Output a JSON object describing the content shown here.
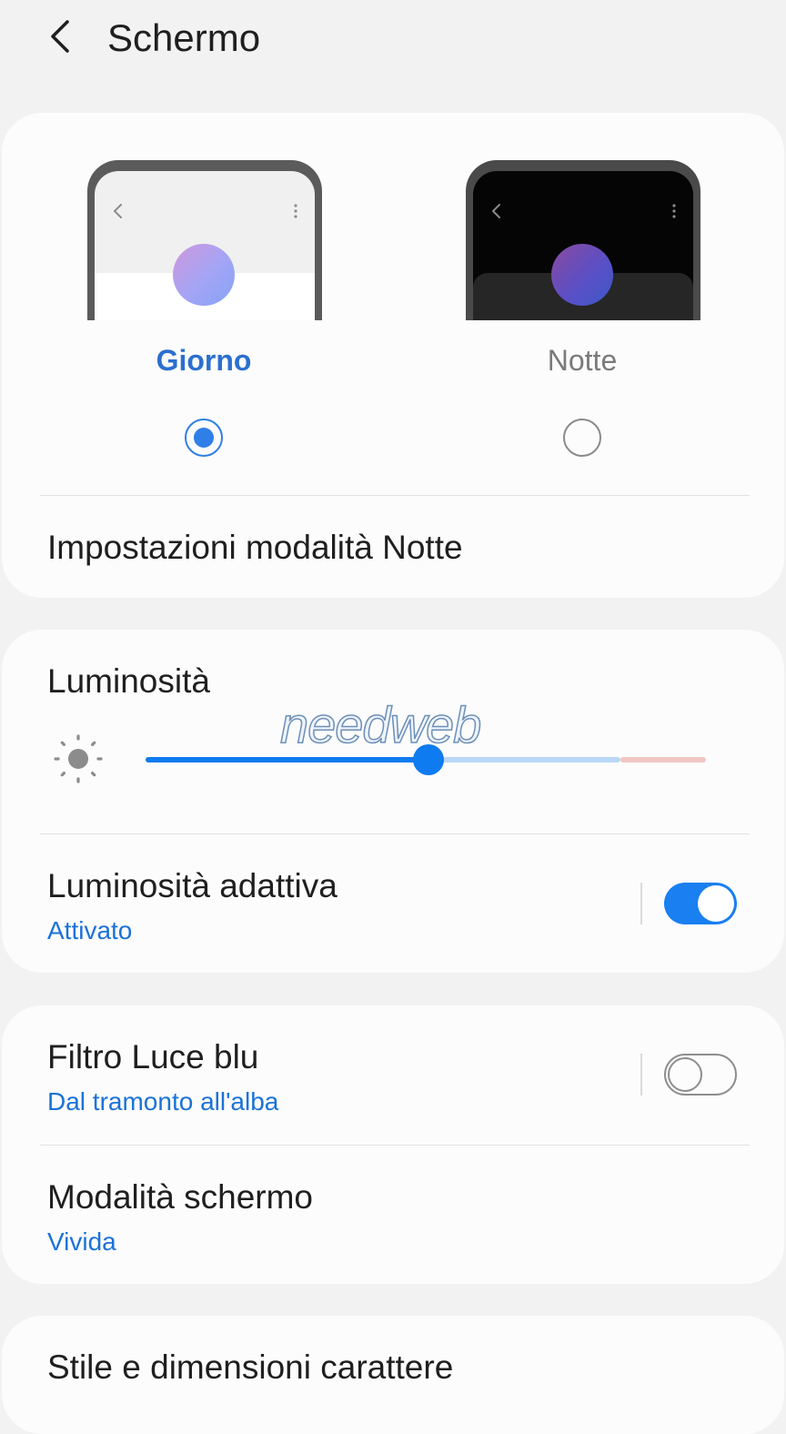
{
  "header": {
    "title": "Schermo",
    "back_icon": "chevron-left-icon"
  },
  "theme": {
    "day": {
      "label": "Giorno",
      "selected": true
    },
    "night": {
      "label": "Notte",
      "selected": false
    },
    "night_settings_label": "Impostazioni modalità Notte"
  },
  "brightness": {
    "title": "Luminosità",
    "icon": "sun-icon",
    "level_percent": 50,
    "watermark": "needweb",
    "adaptive": {
      "title": "Luminosità adattiva",
      "status": "Attivato",
      "enabled": true
    }
  },
  "blue_light": {
    "title": "Filtro Luce blu",
    "status": "Dal tramonto all'alba",
    "enabled": false
  },
  "screen_mode": {
    "title": "Modalità schermo",
    "value": "Vivida"
  },
  "font": {
    "title": "Stile e dimensioni carattere"
  },
  "colors": {
    "accent": "#1a7ff0",
    "link_text": "#1b72d8",
    "background": "#f2f2f2",
    "card": "#fcfcfc"
  }
}
